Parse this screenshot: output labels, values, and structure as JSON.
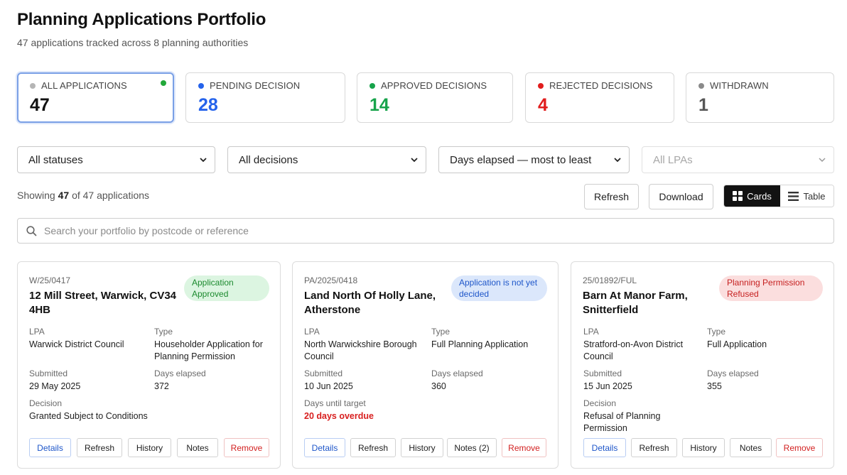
{
  "header": {
    "title": "Planning Applications Portfolio",
    "subtitle": "47 applications tracked across 8 planning authorities"
  },
  "stats": [
    {
      "label": "ALL APPLICATIONS",
      "value": "47",
      "dot_color": "#b5b5b5",
      "value_color": "#111111",
      "active": true
    },
    {
      "label": "PENDING DECISION",
      "value": "28",
      "dot_color": "#2563eb",
      "value_color": "#2563eb"
    },
    {
      "label": "APPROVED DECISIONS",
      "value": "14",
      "dot_color": "#16a34a",
      "value_color": "#16a34a"
    },
    {
      "label": "REJECTED DECISIONS",
      "value": "4",
      "dot_color": "#e11d1d",
      "value_color": "#e11d1d"
    },
    {
      "label": "WITHDRAWN",
      "value": "1",
      "dot_color": "#8a8a8a",
      "value_color": "#555555"
    }
  ],
  "active_indicator_color": "#22a83a",
  "filters": {
    "status": "All statuses",
    "decision": "All decisions",
    "sort": "Days elapsed — most to least",
    "lpa": "All LPAs"
  },
  "summary": {
    "prefix": "Showing",
    "shown": "47",
    "suffix": "of 47 applications"
  },
  "toolbar": {
    "refresh_label": "Refresh",
    "download_label": "Download",
    "cards_label": "Cards",
    "table_label": "Table"
  },
  "search": {
    "placeholder": "Search your portfolio by postcode or reference"
  },
  "labels": {
    "lpa": "LPA",
    "type": "Type",
    "submitted": "Submitted",
    "days_elapsed": "Days elapsed",
    "decision": "Decision",
    "days_until_target": "Days until target"
  },
  "applications": [
    {
      "reference": "W/25/0417",
      "address": "12 Mill Street, Warwick, CV34 4HB",
      "status": "Application Approved",
      "lpa": "Warwick District Council",
      "type": "Householder Application for Planning Permission",
      "submitted": "29 May 2025",
      "days_elapsed": "372",
      "decision": "Granted Subject to Conditions",
      "actions": {
        "details": "Details",
        "refresh": "Refresh",
        "history": "History",
        "notes": "Notes",
        "remove": "Remove"
      }
    },
    {
      "reference": "PA/2025/0418",
      "address": "Land North Of Holly Lane, Atherstone",
      "status": "Application is not yet decided",
      "lpa": "North Warwickshire Borough Council",
      "type": "Full Planning Application",
      "submitted": "10 Jun 2025",
      "days_elapsed": "360",
      "days_until_target": "20 days overdue",
      "actions": {
        "details": "Details",
        "refresh": "Refresh",
        "history": "History",
        "notes": "Notes (2)",
        "remove": "Remove"
      }
    },
    {
      "reference": "25/01892/FUL",
      "address": "Barn At Manor Farm, Snitterfield",
      "status": "Planning Permission Refused",
      "lpa": "Stratford-on-Avon District Council",
      "type": "Full Application",
      "submitted": "15 Jun 2025",
      "days_elapsed": "355",
      "decision": "Refusal of Planning Permission",
      "actions": {
        "details": "Details",
        "refresh": "Refresh",
        "history": "History",
        "notes": "Notes",
        "remove": "Remove"
      }
    }
  ]
}
